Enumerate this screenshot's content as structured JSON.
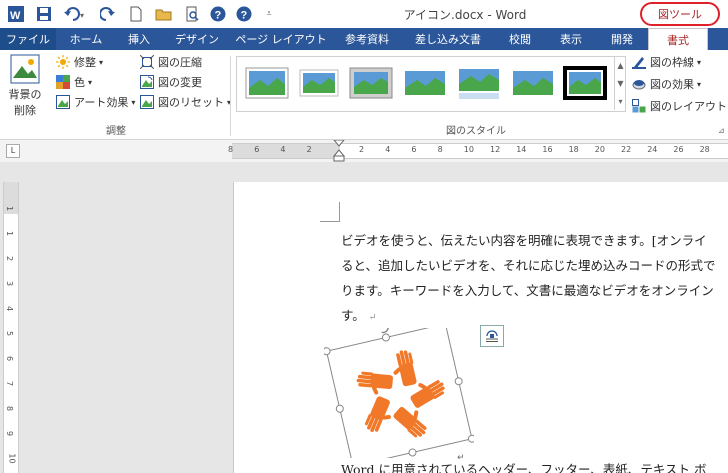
{
  "titlebar": {
    "doc_title": "アイコン.docx - Word",
    "tool_tab_label": "図ツール",
    "quick_access": [
      "word-logo-icon",
      "save-icon",
      "undo-icon",
      "redo-icon",
      "new-doc-icon",
      "open-folder-icon",
      "print-preview-icon",
      "help-icon",
      "help-icon-2",
      "customize-icon"
    ]
  },
  "tabs": [
    "ファイル",
    "ホーム",
    "挿入",
    "デザイン",
    "ページ レイアウト",
    "参考資料",
    "差し込み文書",
    "校閲",
    "表示",
    "開発",
    "書式"
  ],
  "active_tab": "書式",
  "ribbon": {
    "remove_bg": {
      "line1": "背景の",
      "line2": "削除"
    },
    "adjust": {
      "corrections": "修整",
      "color": "色",
      "artistic": "アート効果",
      "compress": "図の圧縮",
      "change": "図の変更",
      "reset": "図のリセット",
      "label": "調整"
    },
    "styles": {
      "label": "図のスタイル"
    },
    "style_options": {
      "border": "図の枠線",
      "effects": "図の効果",
      "layout": "図のレイアウト"
    }
  },
  "ruler": {
    "h_ticks": [
      "8",
      "6",
      "4",
      "2",
      "",
      "2",
      "4",
      "6",
      "8",
      "10",
      "12",
      "14",
      "16",
      "18",
      "20",
      "22",
      "24",
      "26",
      "28"
    ],
    "v_ticks": [
      "1",
      "1",
      "2",
      "3",
      "4",
      "5",
      "6",
      "7",
      "8",
      "9",
      "10"
    ],
    "tab_selector": "L"
  },
  "document": {
    "lines": [
      "ビデオを使うと、伝えたい内容を明確に表現できます。[オンライ",
      "ると、追加したいビデオを、それに応じた埋め込みコードの形式で",
      "ります。キーワードを入力して、文書に最適なビデオをオンライン",
      "す。"
    ],
    "bottom_line": "Word に用意されているヘッダー、フッター、表紙、テキスト ボ",
    "return_mark": "↵"
  },
  "colors": {
    "ribbon_blue": "#2b579a",
    "accent_red": "#a4262c",
    "hand_orange": "#f07828"
  }
}
